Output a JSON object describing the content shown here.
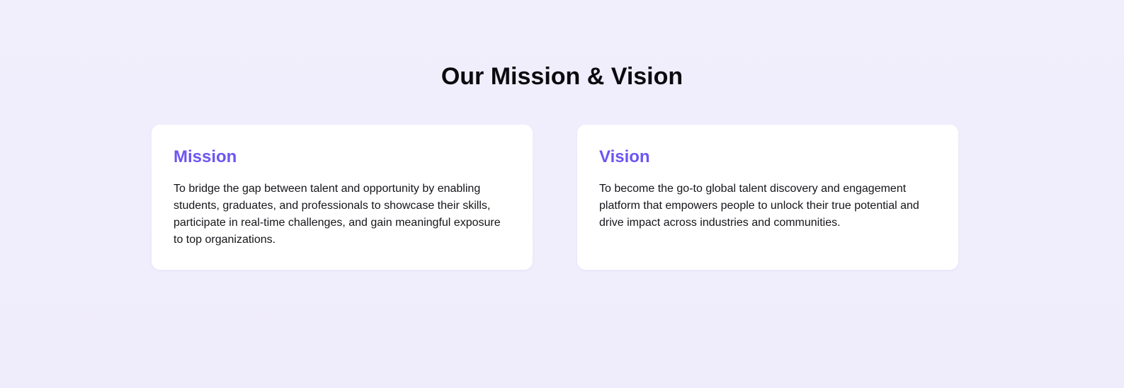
{
  "section": {
    "title": "Our Mission & Vision"
  },
  "cards": [
    {
      "title": "Mission",
      "text": "To bridge the gap between talent and opportunity by enabling students, graduates, and professionals to showcase their skills, participate in real-time challenges, and gain meaningful exposure to top organizations."
    },
    {
      "title": "Vision",
      "text": "To become the go-to global talent discovery and engagement platform that empowers people to unlock their true potential and drive impact across industries and communities."
    }
  ],
  "colors": {
    "accent": "#6c56f2",
    "background": "#f1effc",
    "card": "#ffffff",
    "text": "#15151a"
  }
}
